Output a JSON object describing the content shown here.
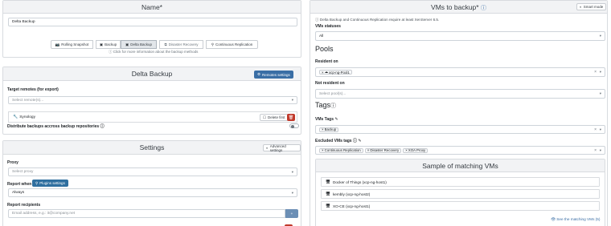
{
  "name_card": {
    "title": "Name*",
    "name_value": "Delta Backup"
  },
  "modes": {
    "items": [
      {
        "icon": "camera-icon",
        "label": "Rolling Snapshot",
        "active": false
      },
      {
        "icon": "save-icon",
        "label": "Backup",
        "active": false
      },
      {
        "icon": "save-icon",
        "label": "Delta Backup",
        "active": true
      },
      {
        "icon": "clone-icon",
        "label": "Disaster Recovery",
        "active": false
      },
      {
        "icon": "plug-icon",
        "label": "Continuous Replication",
        "active": false
      }
    ],
    "info": "Click for more information about the backup methods"
  },
  "delta_backup": {
    "title": "Delta Backup",
    "remotes_settings_label": "Remotes settings",
    "target_remotes_label": "Target remotes (for export)",
    "target_remotes_placeholder": "Select remote(s)...",
    "remote_name": "Synology",
    "delete_first_label": "Delete first",
    "distribute_label": "Distribute backups accross backup repositories"
  },
  "settings": {
    "title": "Settings",
    "advanced_label": "Advanced settings",
    "proxy_label": "Proxy",
    "proxy_placeholder": "Select proxy",
    "report_when_label": "Report when",
    "plugins_label": "Plugins settings",
    "report_when_value": "Always",
    "report_recipients_label": "Report recipients",
    "recipients_placeholder": "Email address, e.g.: it@company.net"
  },
  "vms_card": {
    "title": "VMs to backup*",
    "smart_mode_label": "Smart mode",
    "notice": "Delta Backup and Continuous Replication require at least XenServer 6.5.",
    "vm_statuses_label": "VMs statuses",
    "vm_statuses_value": "All",
    "pools_title": "Pools",
    "resident_on_label": "Resident on",
    "resident_pool": "xcp-ng-Pool1",
    "not_resident_label": "Not resident on",
    "not_resident_placeholder": "Select pool(s)...",
    "tags_title": "Tags",
    "vms_tags_label": "VMs Tags",
    "vms_tags": [
      "Backup"
    ],
    "excluded_tags_label": "Excluded VMs tags",
    "excluded_tags": [
      "Continuous Replication",
      "Disaster Recovery",
      "XOA Proxy"
    ],
    "sample_title": "Sample of matching VMs",
    "sample_vms": [
      "Docker of Things (xcp-ng-host1)",
      "kembly (xcp-ng-host2)",
      "XO-CE (xcp-ng-host1)"
    ],
    "see_all_label": "See the matching VMs (5)"
  },
  "colors": {
    "primary": "#3a6ea5",
    "danger": "#c0392b",
    "header_bg": "#f2f3f5",
    "border": "#d8dbdf"
  }
}
